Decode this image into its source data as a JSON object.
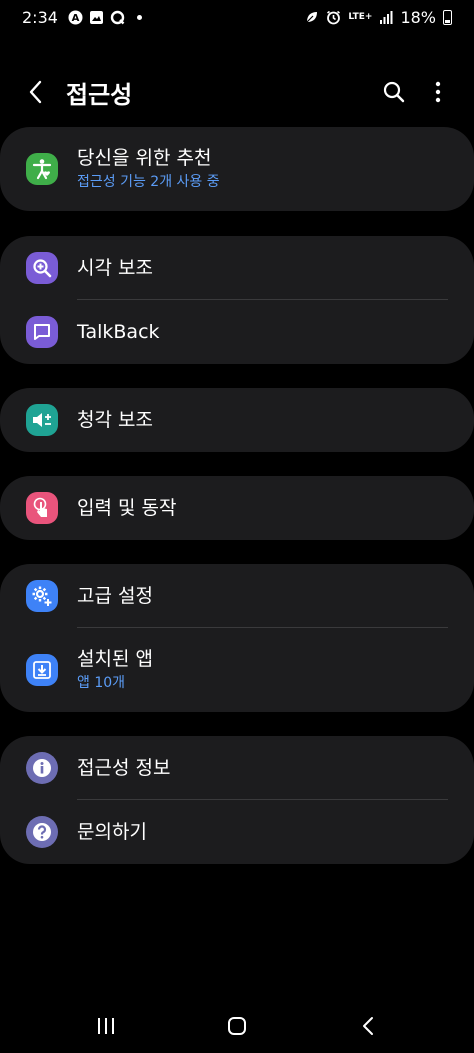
{
  "status_bar": {
    "time": "2:34",
    "battery_percent": "18%",
    "network": "LTE+",
    "icons": [
      "a-circle-icon",
      "gallery-icon",
      "q-icon",
      "dot-icon",
      "leaf-icon",
      "alarm-icon",
      "signal-icon",
      "battery-icon"
    ]
  },
  "header": {
    "title": "접근성",
    "icons": [
      "back-icon",
      "search-icon",
      "more-icon"
    ]
  },
  "sections": [
    {
      "items": [
        {
          "label": "당신을 위한 추천",
          "subtitle": "접근성 기능 2개 사용 중",
          "icon": "accessibility-person-icon",
          "icon_color": "#3fae49"
        }
      ]
    },
    {
      "items": [
        {
          "label": "시각 보조",
          "icon": "zoom-icon",
          "icon_color": "#7a5cd6"
        },
        {
          "label": "TalkBack",
          "icon": "chat-icon",
          "icon_color": "#7a5cd6"
        }
      ]
    },
    {
      "items": [
        {
          "label": "청각 보조",
          "icon": "volume-icon",
          "icon_color": "#1fa394"
        }
      ]
    },
    {
      "items": [
        {
          "label": "입력 및 동작",
          "icon": "touch-icon",
          "icon_color": "#e9547c"
        }
      ]
    },
    {
      "items": [
        {
          "label": "고급 설정",
          "icon": "gear-plus-icon",
          "icon_color": "#3e82f7"
        },
        {
          "label": "설치된 앱",
          "subtitle": "앱 10개",
          "icon": "download-icon",
          "icon_color": "#3e82f7"
        }
      ]
    },
    {
      "items": [
        {
          "label": "접근성 정보",
          "icon": "info-icon",
          "icon_color": "#6d6db3"
        },
        {
          "label": "문의하기",
          "icon": "help-icon",
          "icon_color": "#6d6db3"
        }
      ]
    }
  ],
  "nav_bar": {
    "icons": [
      "recents-icon",
      "home-icon",
      "back-nav-icon"
    ]
  },
  "colors": {
    "background": "#000000",
    "card": "#1c1c1e",
    "subtitle_blue": "#5b9cf6",
    "divider": "#3a3a3c"
  }
}
